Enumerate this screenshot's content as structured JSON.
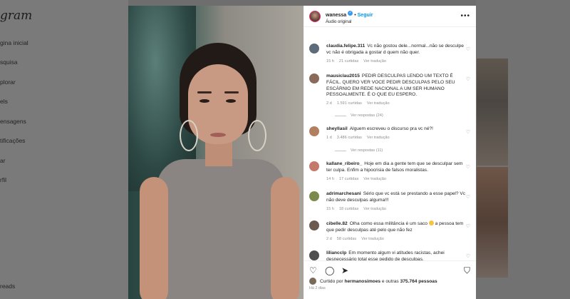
{
  "background": {
    "logo": "gram",
    "nav": [
      "gina inicial",
      "squisa",
      "plorar",
      "els",
      "ensagens",
      "tificações",
      "ar",
      "rfil"
    ],
    "more": "reads"
  },
  "post": {
    "username": "wanessa",
    "follow_label": "Seguir",
    "audio": "Áudio original",
    "dot": "•"
  },
  "comments": [
    {
      "user": "claudia.felipe.311",
      "text": "Vc não gostou dele...normal...não se desculpe vc não é obrigada a gostar d quem não quer.",
      "time": "15 h",
      "likes": "21 curtidas",
      "translate": "Ver tradução"
    },
    {
      "user": "mausiclau2015",
      "text": "PEDIR DESCULPAS LENDO UM TEXTO É FÁCIL. QUERO VER VOCE PEDIR DESCULPAS PELO SEU ESCÁRNIO EM REDE NACIONAL A UM SER HUMANO PESSOALMENTE. É O QUE EU ESPERO.",
      "time": "2 d",
      "likes": "1.591 curtidas",
      "translate": "Ver tradução",
      "replies": "Ver respostas (24)"
    },
    {
      "user": "sheyllasil",
      "text": "Alguem escreveu o discurso pra vc né?!",
      "time": "1 d",
      "likes": "3.486 curtidas",
      "translate": "Ver tradução",
      "replies": "Ver respostas (11)"
    },
    {
      "user": "kallane_ribeiro_",
      "text": "Hoje em dia a gente tem que se desculpar sem ter culpa. Enfim a hipocrisia de falsos moralistas.",
      "time": "14 h",
      "likes": "17 curtidas",
      "translate": "Ver tradução"
    },
    {
      "user": "adrimarchesani",
      "text": "Sério que vc está se prestando a esse papel? Vc não deve desculpas alguma!!!",
      "time": "15 h",
      "likes": "18 curtidas",
      "translate": "Ver tradução"
    },
    {
      "user": "cibelle.82",
      "text_a": "Olha como essa militância é um saco",
      "text_b": "a pessoa tem que pedir desculpas até pelo que não fez",
      "time": "2 d",
      "likes": "58 curtidas",
      "translate": "Ver tradução"
    },
    {
      "user": "liliancclp",
      "text": "Em momento algum vi atitudes racistas, achei desnecessário total esse pedido de desculpas.",
      "time": "",
      "likes": "",
      "translate": ""
    }
  ],
  "icons": {
    "like": "heart-icon",
    "comment": "comment-icon",
    "share": "share-icon",
    "save": "bookmark-icon"
  },
  "liked_by": {
    "prefix": "Curtido por",
    "user": "hermanosimoes",
    "suffix_mid": "e outras",
    "count": "375.764 pessoas"
  },
  "posted_ago": "Há 2 dias",
  "colors": {
    "accent": "#0095f6",
    "verified": "#3897f0"
  }
}
